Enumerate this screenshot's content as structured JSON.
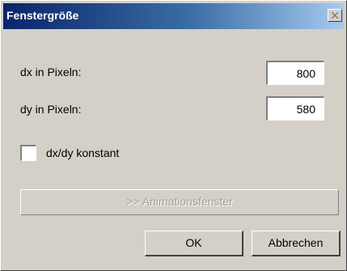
{
  "window": {
    "title": "Fenstergröße",
    "close_icon": "close-icon"
  },
  "form": {
    "dx_label": "dx in Pixeln:",
    "dx_value": "800",
    "dy_label": "dy in Pixeln:",
    "dy_value": "580",
    "constant_label": "dx/dy konstant",
    "constant_checked": false
  },
  "buttons": {
    "animation_label": ">> Animationsfenster",
    "ok_label": "OK",
    "cancel_label": "Abbrechen"
  },
  "colors": {
    "title_gradient_start": "#0a246a",
    "title_gradient_end": "#a6caf0",
    "face": "#d4d0c8",
    "disabled_text": "#a0a0a0"
  }
}
